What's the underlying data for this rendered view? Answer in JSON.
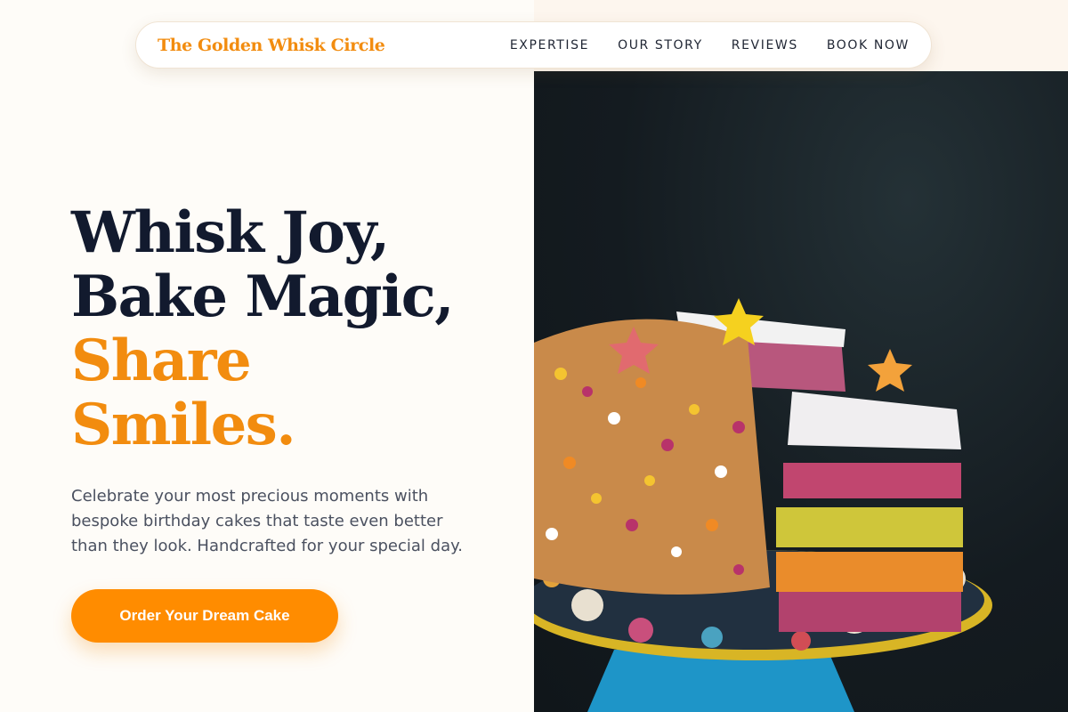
{
  "brand": {
    "name": "The Golden Whisk Circle"
  },
  "nav": {
    "items": [
      {
        "label": "EXPERTISE"
      },
      {
        "label": "OUR STORY"
      },
      {
        "label": "REVIEWS"
      },
      {
        "label": "BOOK NOW"
      }
    ]
  },
  "hero": {
    "headline_line1": "Whisk Joy,",
    "headline_line2": "Bake Magic,",
    "headline_line3": "Share",
    "headline_line4": "Smiles.",
    "description": "Celebrate your most precious moments with bespoke birthday cakes that taste even better than they look. Handcrafted for your special day.",
    "cta_label": "Order Your Dream Cake"
  },
  "colors": {
    "accent": "#f28c0f",
    "button": "#ff8c00",
    "heading": "#121a2e",
    "body_text": "#4b5160",
    "page_bg": "#fefcf8",
    "photo_bg": "#141b20"
  },
  "image": {
    "subject": "rainbow layer birthday cake with star sprinkles on a floral cake stand"
  }
}
